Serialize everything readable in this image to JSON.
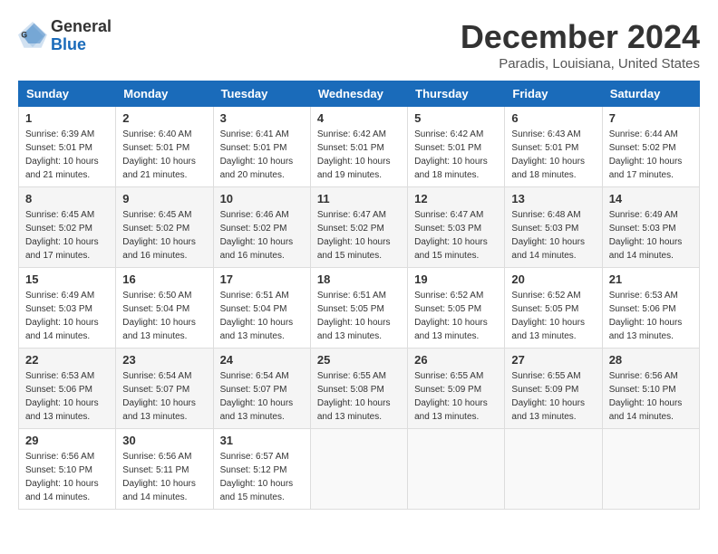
{
  "header": {
    "logo_general": "General",
    "logo_blue": "Blue",
    "title": "December 2024",
    "subtitle": "Paradis, Louisiana, United States"
  },
  "columns": [
    "Sunday",
    "Monday",
    "Tuesday",
    "Wednesday",
    "Thursday",
    "Friday",
    "Saturday"
  ],
  "weeks": [
    [
      {
        "day": "1",
        "sunrise": "Sunrise: 6:39 AM",
        "sunset": "Sunset: 5:01 PM",
        "daylight": "Daylight: 10 hours and 21 minutes."
      },
      {
        "day": "2",
        "sunrise": "Sunrise: 6:40 AM",
        "sunset": "Sunset: 5:01 PM",
        "daylight": "Daylight: 10 hours and 21 minutes."
      },
      {
        "day": "3",
        "sunrise": "Sunrise: 6:41 AM",
        "sunset": "Sunset: 5:01 PM",
        "daylight": "Daylight: 10 hours and 20 minutes."
      },
      {
        "day": "4",
        "sunrise": "Sunrise: 6:42 AM",
        "sunset": "Sunset: 5:01 PM",
        "daylight": "Daylight: 10 hours and 19 minutes."
      },
      {
        "day": "5",
        "sunrise": "Sunrise: 6:42 AM",
        "sunset": "Sunset: 5:01 PM",
        "daylight": "Daylight: 10 hours and 18 minutes."
      },
      {
        "day": "6",
        "sunrise": "Sunrise: 6:43 AM",
        "sunset": "Sunset: 5:01 PM",
        "daylight": "Daylight: 10 hours and 18 minutes."
      },
      {
        "day": "7",
        "sunrise": "Sunrise: 6:44 AM",
        "sunset": "Sunset: 5:02 PM",
        "daylight": "Daylight: 10 hours and 17 minutes."
      }
    ],
    [
      {
        "day": "8",
        "sunrise": "Sunrise: 6:45 AM",
        "sunset": "Sunset: 5:02 PM",
        "daylight": "Daylight: 10 hours and 17 minutes."
      },
      {
        "day": "9",
        "sunrise": "Sunrise: 6:45 AM",
        "sunset": "Sunset: 5:02 PM",
        "daylight": "Daylight: 10 hours and 16 minutes."
      },
      {
        "day": "10",
        "sunrise": "Sunrise: 6:46 AM",
        "sunset": "Sunset: 5:02 PM",
        "daylight": "Daylight: 10 hours and 16 minutes."
      },
      {
        "day": "11",
        "sunrise": "Sunrise: 6:47 AM",
        "sunset": "Sunset: 5:02 PM",
        "daylight": "Daylight: 10 hours and 15 minutes."
      },
      {
        "day": "12",
        "sunrise": "Sunrise: 6:47 AM",
        "sunset": "Sunset: 5:03 PM",
        "daylight": "Daylight: 10 hours and 15 minutes."
      },
      {
        "day": "13",
        "sunrise": "Sunrise: 6:48 AM",
        "sunset": "Sunset: 5:03 PM",
        "daylight": "Daylight: 10 hours and 14 minutes."
      },
      {
        "day": "14",
        "sunrise": "Sunrise: 6:49 AM",
        "sunset": "Sunset: 5:03 PM",
        "daylight": "Daylight: 10 hours and 14 minutes."
      }
    ],
    [
      {
        "day": "15",
        "sunrise": "Sunrise: 6:49 AM",
        "sunset": "Sunset: 5:03 PM",
        "daylight": "Daylight: 10 hours and 14 minutes."
      },
      {
        "day": "16",
        "sunrise": "Sunrise: 6:50 AM",
        "sunset": "Sunset: 5:04 PM",
        "daylight": "Daylight: 10 hours and 13 minutes."
      },
      {
        "day": "17",
        "sunrise": "Sunrise: 6:51 AM",
        "sunset": "Sunset: 5:04 PM",
        "daylight": "Daylight: 10 hours and 13 minutes."
      },
      {
        "day": "18",
        "sunrise": "Sunrise: 6:51 AM",
        "sunset": "Sunset: 5:05 PM",
        "daylight": "Daylight: 10 hours and 13 minutes."
      },
      {
        "day": "19",
        "sunrise": "Sunrise: 6:52 AM",
        "sunset": "Sunset: 5:05 PM",
        "daylight": "Daylight: 10 hours and 13 minutes."
      },
      {
        "day": "20",
        "sunrise": "Sunrise: 6:52 AM",
        "sunset": "Sunset: 5:05 PM",
        "daylight": "Daylight: 10 hours and 13 minutes."
      },
      {
        "day": "21",
        "sunrise": "Sunrise: 6:53 AM",
        "sunset": "Sunset: 5:06 PM",
        "daylight": "Daylight: 10 hours and 13 minutes."
      }
    ],
    [
      {
        "day": "22",
        "sunrise": "Sunrise: 6:53 AM",
        "sunset": "Sunset: 5:06 PM",
        "daylight": "Daylight: 10 hours and 13 minutes."
      },
      {
        "day": "23",
        "sunrise": "Sunrise: 6:54 AM",
        "sunset": "Sunset: 5:07 PM",
        "daylight": "Daylight: 10 hours and 13 minutes."
      },
      {
        "day": "24",
        "sunrise": "Sunrise: 6:54 AM",
        "sunset": "Sunset: 5:07 PM",
        "daylight": "Daylight: 10 hours and 13 minutes."
      },
      {
        "day": "25",
        "sunrise": "Sunrise: 6:55 AM",
        "sunset": "Sunset: 5:08 PM",
        "daylight": "Daylight: 10 hours and 13 minutes."
      },
      {
        "day": "26",
        "sunrise": "Sunrise: 6:55 AM",
        "sunset": "Sunset: 5:09 PM",
        "daylight": "Daylight: 10 hours and 13 minutes."
      },
      {
        "day": "27",
        "sunrise": "Sunrise: 6:55 AM",
        "sunset": "Sunset: 5:09 PM",
        "daylight": "Daylight: 10 hours and 13 minutes."
      },
      {
        "day": "28",
        "sunrise": "Sunrise: 6:56 AM",
        "sunset": "Sunset: 5:10 PM",
        "daylight": "Daylight: 10 hours and 14 minutes."
      }
    ],
    [
      {
        "day": "29",
        "sunrise": "Sunrise: 6:56 AM",
        "sunset": "Sunset: 5:10 PM",
        "daylight": "Daylight: 10 hours and 14 minutes."
      },
      {
        "day": "30",
        "sunrise": "Sunrise: 6:56 AM",
        "sunset": "Sunset: 5:11 PM",
        "daylight": "Daylight: 10 hours and 14 minutes."
      },
      {
        "day": "31",
        "sunrise": "Sunrise: 6:57 AM",
        "sunset": "Sunset: 5:12 PM",
        "daylight": "Daylight: 10 hours and 15 minutes."
      },
      null,
      null,
      null,
      null
    ]
  ]
}
